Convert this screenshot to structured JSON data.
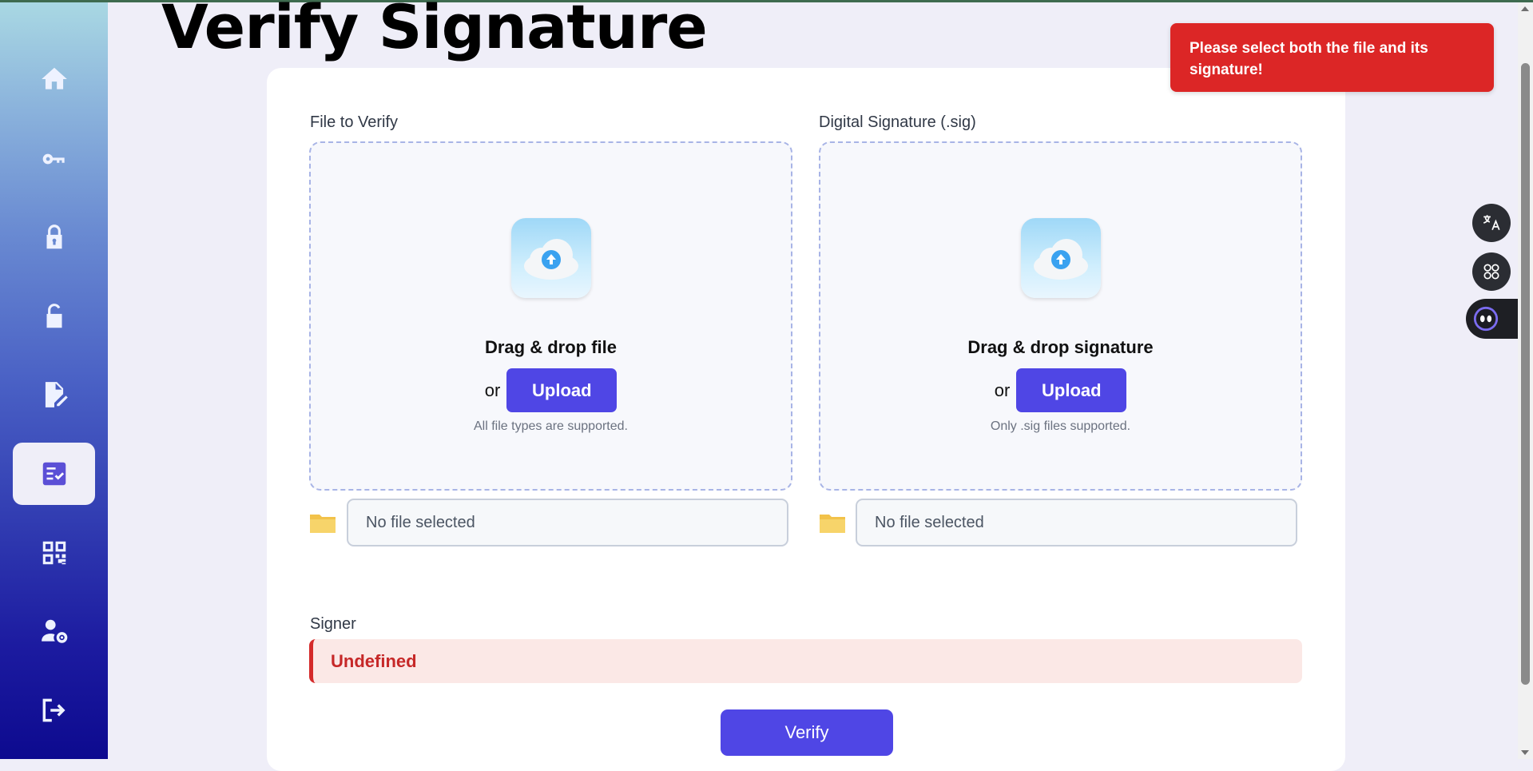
{
  "page": {
    "title": "Verify Signature"
  },
  "sidebar": {
    "items": [
      {
        "icon": "home-icon",
        "active": false
      },
      {
        "icon": "key-icon",
        "active": false
      },
      {
        "icon": "lock-icon",
        "active": false
      },
      {
        "icon": "unlock-icon",
        "active": false
      },
      {
        "icon": "sign-document-icon",
        "active": false
      },
      {
        "icon": "verify-document-icon",
        "active": true
      },
      {
        "icon": "qr-code-icon",
        "active": false
      },
      {
        "icon": "user-settings-icon",
        "active": false
      },
      {
        "icon": "logout-icon",
        "active": false
      }
    ]
  },
  "file_section": {
    "label": "File to Verify",
    "title": "Drag & drop file",
    "or_text": "or",
    "upload_label": "Upload",
    "hint": "All file types are supported.",
    "file_name": "No file selected"
  },
  "signature_section": {
    "label": "Digital Signature (.sig)",
    "title": "Drag & drop signature",
    "or_text": "or",
    "upload_label": "Upload",
    "hint": "Only .sig files supported.",
    "file_name": "No file selected"
  },
  "signer": {
    "label": "Signer",
    "value": "Undefined"
  },
  "verify_button": {
    "label": "Verify"
  },
  "toast": {
    "message": "Please select both the file and its signature!"
  },
  "floating_tools": [
    "translate-icon",
    "apps-icon",
    "assistant-icon"
  ],
  "colors": {
    "accent": "#4f46e5",
    "error": "#dc2626",
    "signer_bg": "#fbe8e6",
    "sidebar_top": "#a9d8e3",
    "sidebar_bottom": "#0d0a8f"
  }
}
